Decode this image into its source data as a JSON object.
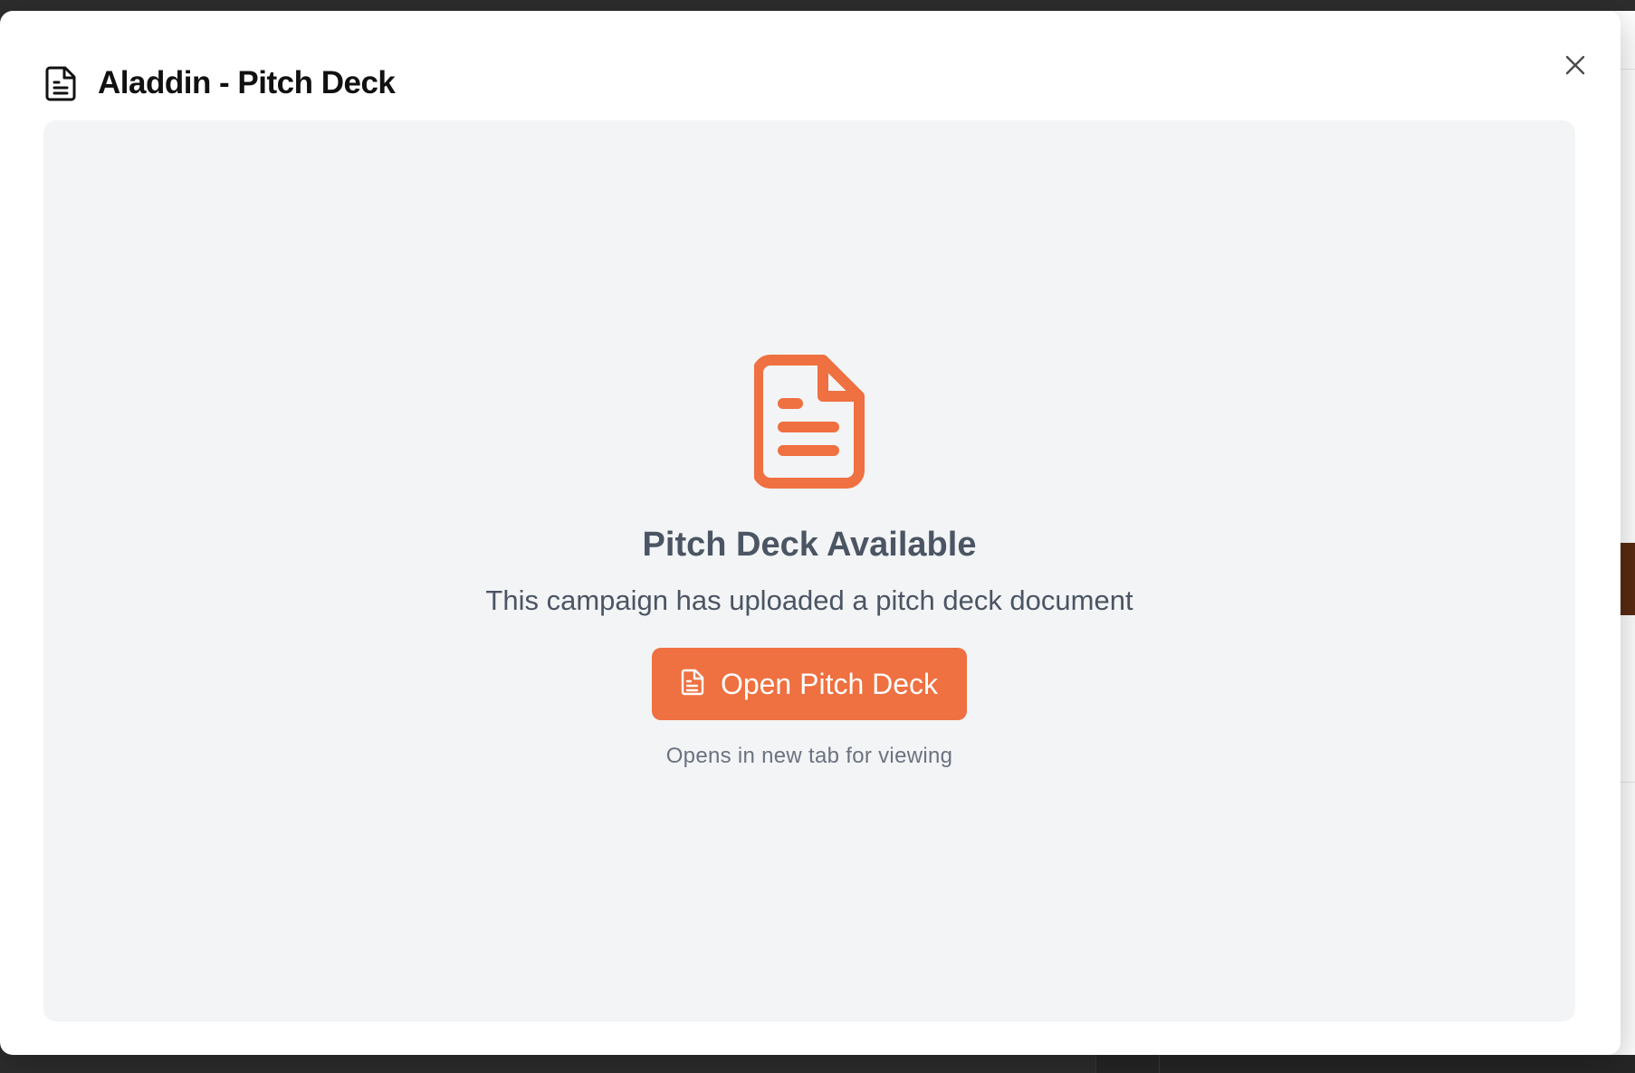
{
  "modal": {
    "title": "Aladdin - Pitch Deck",
    "close_icon": "close-icon",
    "title_icon": "document-icon"
  },
  "preview": {
    "icon": "document-icon",
    "heading": "Pitch Deck Available",
    "description": "This campaign has uploaded a pitch deck document",
    "open_button_label": "Open Pitch Deck",
    "open_button_icon": "document-icon",
    "hint": "Opens in new tab for viewing"
  },
  "colors": {
    "accent": "#ef7040",
    "panel_background": "#f3f4f6",
    "muted_text": "#6b7280",
    "heading_text": "#4b5563"
  }
}
